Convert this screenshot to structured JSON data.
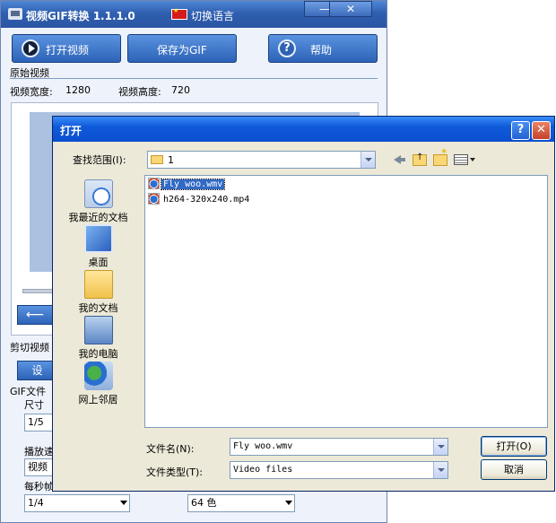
{
  "app": {
    "title": "视频GIF转换 1.1.1.0",
    "language_label": "切换语言",
    "window_min_symbol": "—",
    "window_close_symbol": "✕",
    "open_video_label": "打开视频",
    "save_gif_label": "保存为GIF",
    "help_label": "帮助",
    "help_symbol": "?",
    "original_video_label": "原始视频",
    "video_width_label": "视频宽度:",
    "video_width_value": "1280",
    "video_height_label": "视频高度:",
    "video_height_value": "720",
    "back_arrow": "⟵",
    "cut_video_label": "剪切视频",
    "settings_button_label": "设",
    "gif_file_label": "GIF文件",
    "size_label": "尺寸",
    "size_value": "1/5",
    "play_speed_label": "播放速",
    "play_speed_value": "视频",
    "fps_label": "每秒帧",
    "fps_value": "1/4",
    "colors_value": "64 色"
  },
  "dialog": {
    "title": "打开",
    "help_symbol": "?",
    "close_symbol": "✕",
    "look_in_label": "查找范围(I):",
    "look_in_value": "1",
    "places": [
      {
        "label": "我最近的文档"
      },
      {
        "label": "桌面"
      },
      {
        "label": "我的文档"
      },
      {
        "label": "我的电脑"
      },
      {
        "label": "网上邻居"
      }
    ],
    "files": [
      {
        "name": "Fly woo.wmv",
        "selected": true
      },
      {
        "name": "h264-320x240.mp4",
        "selected": false
      }
    ],
    "filename_label": "文件名(N):",
    "filename_value": "Fly woo.wmv",
    "filetype_label": "文件类型(T):",
    "filetype_value": "Video files",
    "open_button_label": "打开(O)",
    "cancel_button_label": "取消"
  }
}
